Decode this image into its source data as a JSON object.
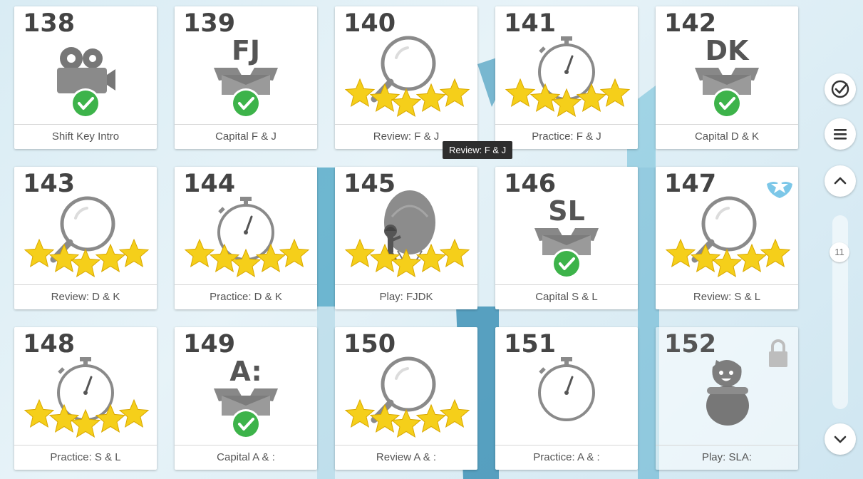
{
  "lessons": [
    {
      "number": "138",
      "label": "Shift Key Intro",
      "type": "video",
      "letters": "",
      "status": "complete"
    },
    {
      "number": "139",
      "label": "Capital F & J",
      "type": "box",
      "letters": "FJ",
      "status": "complete"
    },
    {
      "number": "140",
      "label": "Review: F & J",
      "type": "review",
      "letters": "",
      "status": "stars",
      "stars": 5
    },
    {
      "number": "141",
      "label": "Practice: F & J",
      "type": "practice",
      "letters": "",
      "status": "stars",
      "stars": 5
    },
    {
      "number": "142",
      "label": "Capital D & K",
      "type": "box",
      "letters": "DK",
      "status": "complete"
    },
    {
      "number": "143",
      "label": "Review: D & K",
      "type": "review",
      "letters": "",
      "status": "stars",
      "stars": 5
    },
    {
      "number": "144",
      "label": "Practice: D & K",
      "type": "practice",
      "letters": "",
      "status": "stars",
      "stars": 5
    },
    {
      "number": "145",
      "label": "Play: FJDK",
      "type": "play",
      "letters": "",
      "status": "stars",
      "stars": 5
    },
    {
      "number": "146",
      "label": "Capital S & L",
      "type": "box",
      "letters": "SL",
      "status": "complete"
    },
    {
      "number": "147",
      "label": "Review: S & L",
      "type": "review",
      "letters": "",
      "status": "stars",
      "stars": 5,
      "badge": "star-wings-badge-icon"
    },
    {
      "number": "148",
      "label": "Practice: S & L",
      "type": "practice",
      "letters": "",
      "status": "stars",
      "stars": 5
    },
    {
      "number": "149",
      "label": "Capital A & :",
      "type": "box",
      "letters": "A:",
      "status": "complete"
    },
    {
      "number": "150",
      "label": "Review A & :",
      "type": "review",
      "letters": "",
      "status": "stars",
      "stars": 5
    },
    {
      "number": "151",
      "label": "Practice: A & :",
      "type": "practice",
      "letters": "",
      "status": "none"
    },
    {
      "number": "152",
      "label": "Play: SLA:",
      "type": "play-locked",
      "letters": "",
      "status": "locked"
    }
  ],
  "tooltip": "Review: F & J",
  "sidebar": {
    "progress_icon": "check-circle-icon",
    "menu_icon": "hamburger-menu-icon",
    "up_icon": "chevron-up-icon",
    "down_icon": "chevron-down-icon",
    "scroll_position": "11"
  },
  "colors": {
    "star": "#f5cf1a",
    "check": "#3db34a",
    "icon_gray": "#8a8a8a",
    "tooltip_bg": "#2e2e2e"
  }
}
